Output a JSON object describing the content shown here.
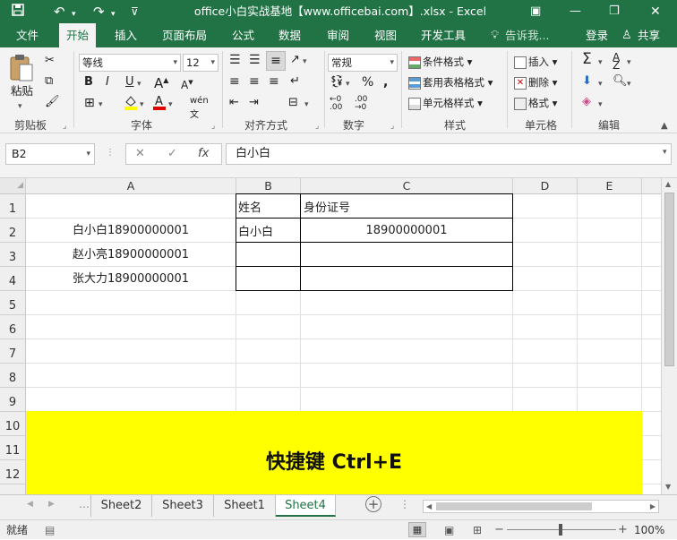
{
  "title": "office小白实战基地【www.officebai.com】.xlsx - Excel",
  "menu": {
    "tabs": [
      "文件",
      "开始",
      "插入",
      "页面布局",
      "公式",
      "数据",
      "审阅",
      "视图",
      "开发工具"
    ],
    "tell_me": "告诉我...",
    "login": "登录",
    "share": "共享"
  },
  "ribbon": {
    "clipboard": {
      "paste": "粘贴",
      "label": "剪贴板"
    },
    "font": {
      "name": "等线",
      "size": "12",
      "label": "字体"
    },
    "alignment": {
      "label": "对齐方式"
    },
    "number": {
      "format": "常规",
      "label": "数字"
    },
    "styles": {
      "conditional": "条件格式",
      "table": "套用表格格式",
      "cell": "单元格样式",
      "label": "样式"
    },
    "cells": {
      "insert": "插入",
      "delete": "删除",
      "format": "格式",
      "label": "单元格"
    },
    "editing": {
      "label": "编辑"
    }
  },
  "formula_bar": {
    "name_box": "B2",
    "formula": "白小白"
  },
  "sheet": {
    "columns": [
      "A",
      "B",
      "C",
      "D",
      "E"
    ],
    "rows": [
      "1",
      "2",
      "3",
      "4",
      "5",
      "6",
      "7",
      "8",
      "9",
      "10",
      "11",
      "12"
    ],
    "cells": {
      "A2": "白小白18900000001",
      "A3": "赵小亮18900000001",
      "A4": "张大力18900000001",
      "B1": "姓名",
      "B2": "白小白",
      "C1": "身份证号",
      "C2": "18900000001"
    },
    "banner": "快捷键 Ctrl+E",
    "banner_color": "#ffff00"
  },
  "sheet_tabs": [
    "Sheet2",
    "Sheet3",
    "Sheet1",
    "Sheet4"
  ],
  "active_sheet": "Sheet4",
  "status": {
    "ready": "就绪",
    "zoom": "100%"
  },
  "colors": {
    "brand": "#217346"
  }
}
